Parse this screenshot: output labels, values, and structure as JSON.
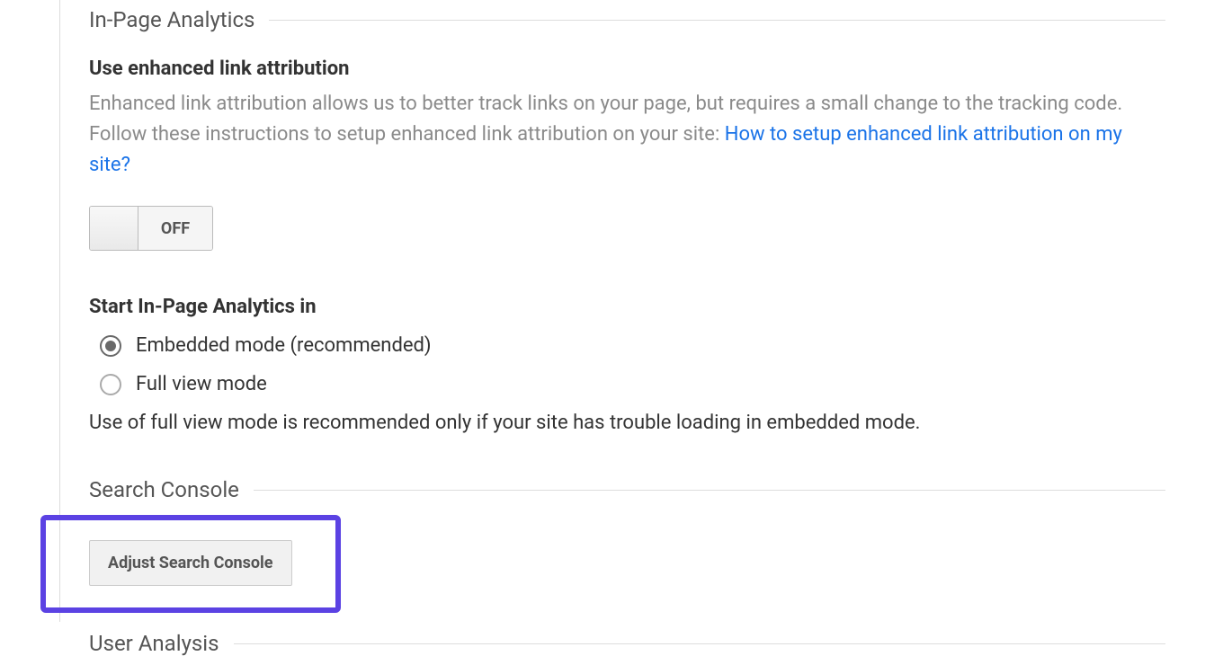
{
  "sections": {
    "in_page_analytics": {
      "title": "In-Page Analytics",
      "enhanced_link": {
        "title": "Use enhanced link attribution",
        "description_prefix": "Enhanced link attribution allows us to better track links on your page, but requires a small change to the tracking code. Follow these instructions to setup enhanced link attribution on your site: ",
        "link_text": "How to setup enhanced link attribution on my site?",
        "toggle_state": "OFF"
      },
      "start_mode": {
        "title": "Start In-Page Analytics in",
        "options": [
          {
            "label": "Embedded mode (recommended)",
            "selected": true
          },
          {
            "label": "Full view mode",
            "selected": false
          }
        ],
        "help": "Use of full view mode is recommended only if your site has trouble loading in embedded mode."
      }
    },
    "search_console": {
      "title": "Search Console",
      "button_label": "Adjust Search Console"
    },
    "user_analysis": {
      "title": "User Analysis"
    }
  }
}
